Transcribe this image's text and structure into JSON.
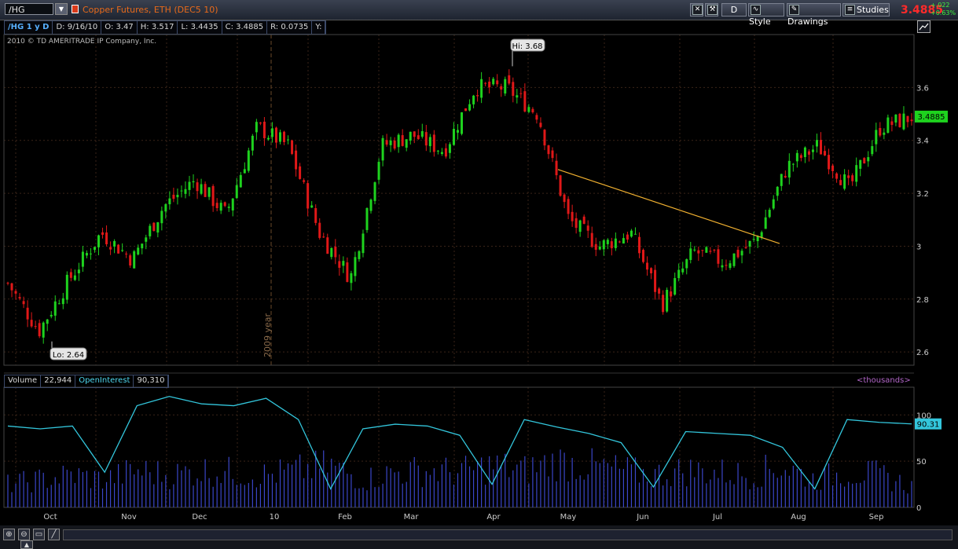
{
  "toolbar": {
    "symbol": "/HG",
    "description": "Copper Futures, ETH (DEC5 10)",
    "aggregation": "D",
    "style_label": "Style",
    "drawings_label": "Drawings",
    "studies_label": "Studies",
    "last_price": "3.4885",
    "change": "+.022",
    "change_pct": "+0.63%"
  },
  "infobar": {
    "symbol": "/HG 1 y D",
    "date": "D: 9/16/10",
    "open": "O: 3.47",
    "high": "H: 3.517",
    "low": "L: 3.4435",
    "close": "C: 3.4885",
    "range": "R: 0.0735",
    "y": "Y:"
  },
  "copyright": "2010 © TD AMERITRADE IP Company, Inc.",
  "volume_bar": {
    "volume_label": "Volume",
    "volume_value": "22,944",
    "oi_label": "OpenInterest",
    "oi_value": "90,310",
    "units": "<thousands>"
  },
  "colors": {
    "up": "#1ed21e",
    "down": "#e01818",
    "trendline": "#f0b030",
    "open_interest": "#33c6dc",
    "volume": "#3a46c8",
    "grid": "#3a2418"
  },
  "chart_data": [
    {
      "type": "candlestick",
      "title": "/HG 1 y D",
      "ylim": [
        2.55,
        3.8
      ],
      "yticks": [
        2.6,
        2.8,
        3,
        3.2,
        3.4,
        3.6
      ],
      "ytick_labels": [
        "2.6",
        "2.8",
        "3",
        "3.2",
        "3.4",
        "3.6"
      ],
      "x_months": [
        "Oct",
        "Nov",
        "Dec",
        "10",
        "Feb",
        "Mar",
        "Apr",
        "May",
        "Jun",
        "Jul",
        "Aug",
        "Sep"
      ],
      "year_marker": "2009 year",
      "hi_label": "Hi: 3.68",
      "lo_label": "Lo: 2.64",
      "hi": 3.68,
      "lo": 2.64,
      "last_price_label": "3.4885",
      "last_price": 3.4885,
      "close_path": [
        {
          "month": "Oct",
          "value": 2.86
        },
        {
          "month": "Oct",
          "value": 2.68
        },
        {
          "month": "Oct",
          "value": 2.88
        },
        {
          "month": "Nov",
          "value": 3.05
        },
        {
          "month": "Nov",
          "value": 2.95
        },
        {
          "month": "Dec",
          "value": 3.15
        },
        {
          "month": "Dec",
          "value": 3.25
        },
        {
          "month": "Dec",
          "value": 3.12
        },
        {
          "month": "10",
          "value": 3.45
        },
        {
          "month": "10",
          "value": 3.38
        },
        {
          "month": "Feb",
          "value": 3.05
        },
        {
          "month": "Feb",
          "value": 2.88
        },
        {
          "month": "Feb",
          "value": 3.38
        },
        {
          "month": "Mar",
          "value": 3.42
        },
        {
          "month": "Mar",
          "value": 3.36
        },
        {
          "month": "Apr",
          "value": 3.6
        },
        {
          "month": "Apr",
          "value": 3.6
        },
        {
          "month": "Apr",
          "value": 3.5
        },
        {
          "month": "May",
          "value": 3.1
        },
        {
          "month": "May",
          "value": 3.0
        },
        {
          "month": "Jun",
          "value": 3.05
        },
        {
          "month": "Jun",
          "value": 2.78
        },
        {
          "month": "Jun",
          "value": 2.98
        },
        {
          "month": "Jul",
          "value": 2.94
        },
        {
          "month": "Jul",
          "value": 3.02
        },
        {
          "month": "Aug",
          "value": 3.3
        },
        {
          "month": "Aug",
          "value": 3.38
        },
        {
          "month": "Aug",
          "value": 3.22
        },
        {
          "month": "Sep",
          "value": 3.45
        },
        {
          "month": "Sep",
          "value": 3.4885
        }
      ],
      "trendline": [
        {
          "month": "Apr",
          "value": 3.29
        },
        {
          "month": "Jul",
          "value": 3.01
        }
      ]
    },
    {
      "type": "line",
      "name": "OpenInterest",
      "ylim": [
        0,
        130
      ],
      "yticks": [
        0,
        50,
        100
      ],
      "ytick_labels": [
        "0",
        "50",
        "100"
      ],
      "last_value_label": "90.31",
      "series": [
        {
          "name": "OpenInterest",
          "values": [
            88,
            85,
            88,
            38,
            110,
            120,
            112,
            110,
            118,
            95,
            20,
            85,
            90,
            88,
            78,
            25,
            95,
            87,
            80,
            70,
            22,
            82,
            80,
            78,
            65,
            20,
            95,
            92,
            90.31
          ]
        },
        {
          "name": "Volume",
          "values": [
            25,
            30,
            35,
            30,
            40,
            35,
            40,
            38,
            35,
            40,
            45,
            30,
            38,
            40,
            38,
            45,
            40,
            50,
            45,
            40,
            35,
            40,
            38,
            35,
            45,
            30,
            38,
            35,
            22.944
          ]
        }
      ]
    }
  ]
}
